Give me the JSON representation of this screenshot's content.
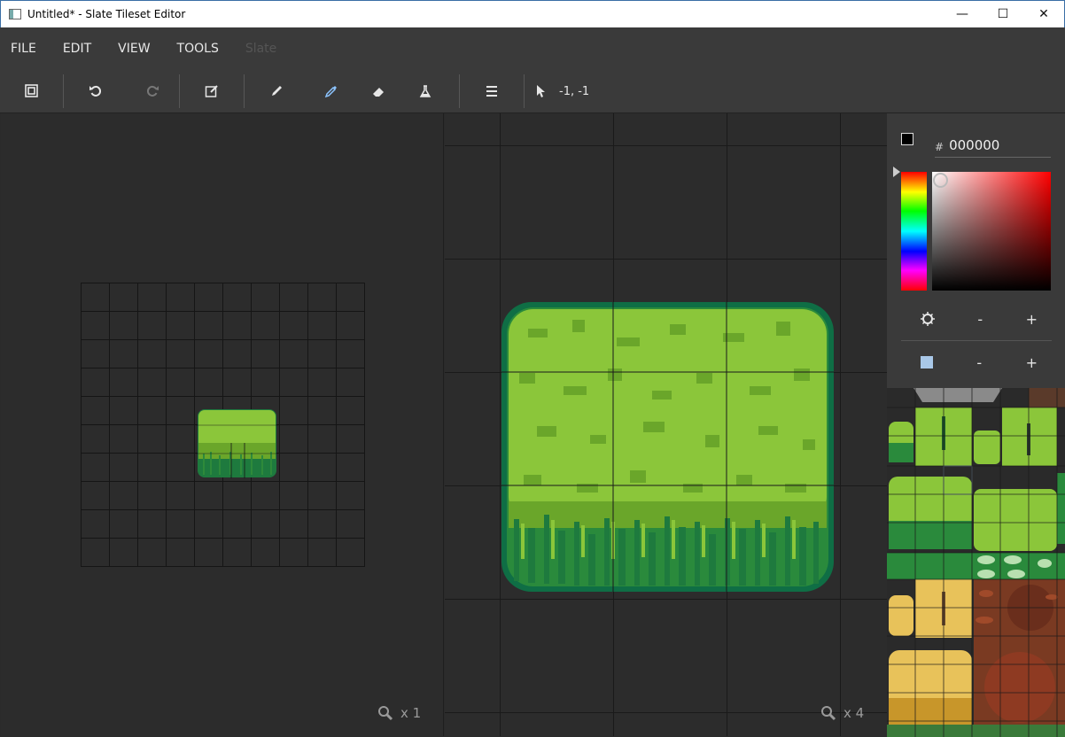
{
  "window": {
    "title": "Untitled* - Slate Tileset Editor",
    "minimize_glyph": "—",
    "maximize_glyph": "☐",
    "close_glyph": "✕"
  },
  "menu": {
    "items": [
      "FILE",
      "EDIT",
      "VIEW",
      "TOOLS"
    ],
    "disabled_item": "Slate"
  },
  "toolbar": {
    "icons": [
      "canvas-size-icon",
      "undo-icon",
      "redo-icon",
      "edit-icon",
      "pencil-icon",
      "eyedropper-icon",
      "eraser-icon",
      "fill-icon",
      "menu-icon",
      "cursor-icon"
    ],
    "cursor_coords": "-1, -1"
  },
  "left_view": {
    "zoom_label": "x 1"
  },
  "center_view": {
    "zoom_label": "x 4"
  },
  "color_panel": {
    "hash": "#",
    "hex_value": "000000",
    "brush_minus": "-",
    "brush_plus": "+",
    "tile_minus": "-",
    "tile_plus": "+"
  },
  "colors": {
    "grass_light": "#8bc63a",
    "grass_mid": "#6aa62a",
    "grass_dark": "#1e7a3e",
    "edge": "#0f6e45",
    "sand": "#e8c25a",
    "dirt": "#7a3a22"
  }
}
